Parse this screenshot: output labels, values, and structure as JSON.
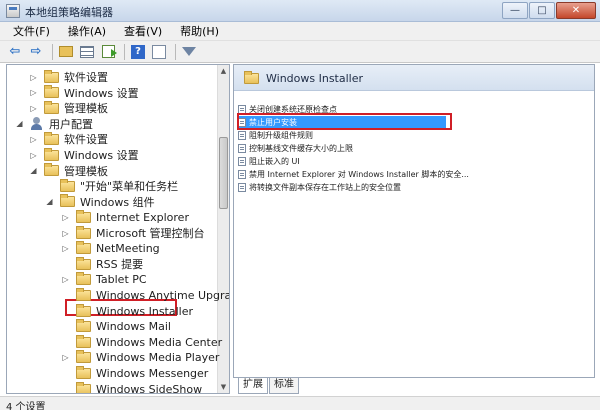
{
  "window": {
    "title": "本地组策略编辑器",
    "minimize": "—",
    "maximize": "□",
    "close": "✕"
  },
  "menu": [
    "文件(F)",
    "操作(A)",
    "查看(V)",
    "帮助(H)"
  ],
  "tree": [
    {
      "label": "软件设置",
      "indent": 1,
      "expander": "▷",
      "icon": "folder-icon"
    },
    {
      "label": "Windows 设置",
      "indent": 1,
      "expander": "▷",
      "icon": "folder-icon"
    },
    {
      "label": "管理模板",
      "indent": 1,
      "expander": "▷",
      "icon": "folder-icon"
    },
    {
      "label": "用户配置",
      "indent": 0,
      "expander": "◢",
      "icon": "user-icon"
    },
    {
      "label": "软件设置",
      "indent": 1,
      "expander": "▷",
      "icon": "folder-icon"
    },
    {
      "label": "Windows 设置",
      "indent": 1,
      "expander": "▷",
      "icon": "folder-icon"
    },
    {
      "label": "管理模板",
      "indent": 1,
      "expander": "◢",
      "icon": "folder-icon"
    },
    {
      "label": "\"开始\"菜单和任务栏",
      "indent": 2,
      "expander": "",
      "icon": "folder-icon"
    },
    {
      "label": "Windows 组件",
      "indent": 2,
      "expander": "◢",
      "icon": "folder-icon"
    },
    {
      "label": "Internet Explorer",
      "indent": 3,
      "expander": "▷",
      "icon": "folder-icon"
    },
    {
      "label": "Microsoft 管理控制台",
      "indent": 3,
      "expander": "▷",
      "icon": "folder-icon"
    },
    {
      "label": "NetMeeting",
      "indent": 3,
      "expander": "▷",
      "icon": "folder-icon"
    },
    {
      "label": "RSS 提要",
      "indent": 3,
      "expander": "",
      "icon": "folder-icon"
    },
    {
      "label": "Tablet PC",
      "indent": 3,
      "expander": "▷",
      "icon": "folder-icon"
    },
    {
      "label": "Windows Anytime Upgrade",
      "indent": 3,
      "expander": "",
      "icon": "folder-icon"
    },
    {
      "label": "Windows Installer",
      "indent": 3,
      "expander": "",
      "icon": "folder-icon",
      "highlighted": true
    },
    {
      "label": "Windows Mail",
      "indent": 3,
      "expander": "",
      "icon": "folder-icon"
    },
    {
      "label": "Windows Media Center",
      "indent": 3,
      "expander": "",
      "icon": "folder-icon"
    },
    {
      "label": "Windows Media Player",
      "indent": 3,
      "expander": "▷",
      "icon": "folder-icon"
    },
    {
      "label": "Windows Messenger",
      "indent": 3,
      "expander": "",
      "icon": "folder-icon"
    },
    {
      "label": "Windows SideShow",
      "indent": 3,
      "expander": "",
      "icon": "folder-icon"
    }
  ],
  "right_pane": {
    "header": "Windows Installer",
    "policies": [
      {
        "label": "关闭创建系统还原检查点",
        "selected": false
      },
      {
        "label": "禁止用户安装",
        "selected": true
      },
      {
        "label": "阻制升级组件规则",
        "selected": false
      },
      {
        "label": "控制基线文件缓存大小的上限",
        "selected": false
      },
      {
        "label": "阻止嵌入的 UI",
        "selected": false
      },
      {
        "label": "禁用 Internet Explorer 对 Windows Installer 脚本的安全...",
        "selected": false
      },
      {
        "label": "将转换文件副本保存在工作站上的安全位置",
        "selected": false
      }
    ]
  },
  "tabs": [
    {
      "label": "扩展",
      "active": true
    },
    {
      "label": "标准",
      "active": false
    }
  ],
  "status": "4 个设置",
  "colors": {
    "selection": "#3399ff",
    "highlight_border": "#d01f26"
  }
}
